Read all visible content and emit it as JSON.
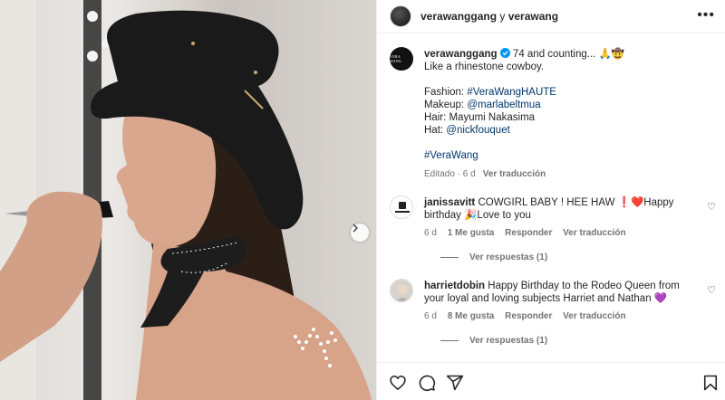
{
  "header": {
    "author": "verawanggang",
    "separator": " y ",
    "coauthor": "verawang",
    "more_icon": "more-horizontal-icon"
  },
  "caption": {
    "avatar_text": "VERA WANG",
    "username": "verawanggang",
    "line1_text": " 74 and counting... 🙏🤠",
    "line2": "Like a rhinestone cowboy.",
    "fashion_label": "Fashion: ",
    "fashion_tag": "#VeraWangHAUTE",
    "makeup_label": "Makeup: ",
    "makeup_tag": "@marlabeltmua",
    "hair": "Hair: Mayumi Nakasima",
    "hat_label": "Hat: ",
    "hat_tag": "@nickfouquet",
    "hashtag": "#VeraWang",
    "edited": "Editado · 6 d",
    "translate": "Ver traducción"
  },
  "comments": [
    {
      "username": "janissavitt",
      "text": " COWGIRL BABY ! HEE HAW ❗❤️Happy birthday 🎉Love to you",
      "time": "6 d",
      "likes": "1 Me gusta",
      "reply": "Responder",
      "translate": "Ver traducción",
      "replies": "Ver respuestas (1)"
    },
    {
      "username": "harrietdobin",
      "text": " Happy Birthday to the Rodeo Queen from your loyal and loving subjects Harriet and Nathan 💜",
      "time": "6 d",
      "likes": "8 Me gusta",
      "reply": "Responder",
      "translate": "Ver traducción",
      "replies": "Ver respuestas (1)"
    }
  ],
  "actions": [
    "heart-icon",
    "comment-icon",
    "share-icon",
    "bookmark-icon"
  ],
  "colors": {
    "link": "#00376b",
    "muted": "#737373",
    "text": "#262626"
  }
}
